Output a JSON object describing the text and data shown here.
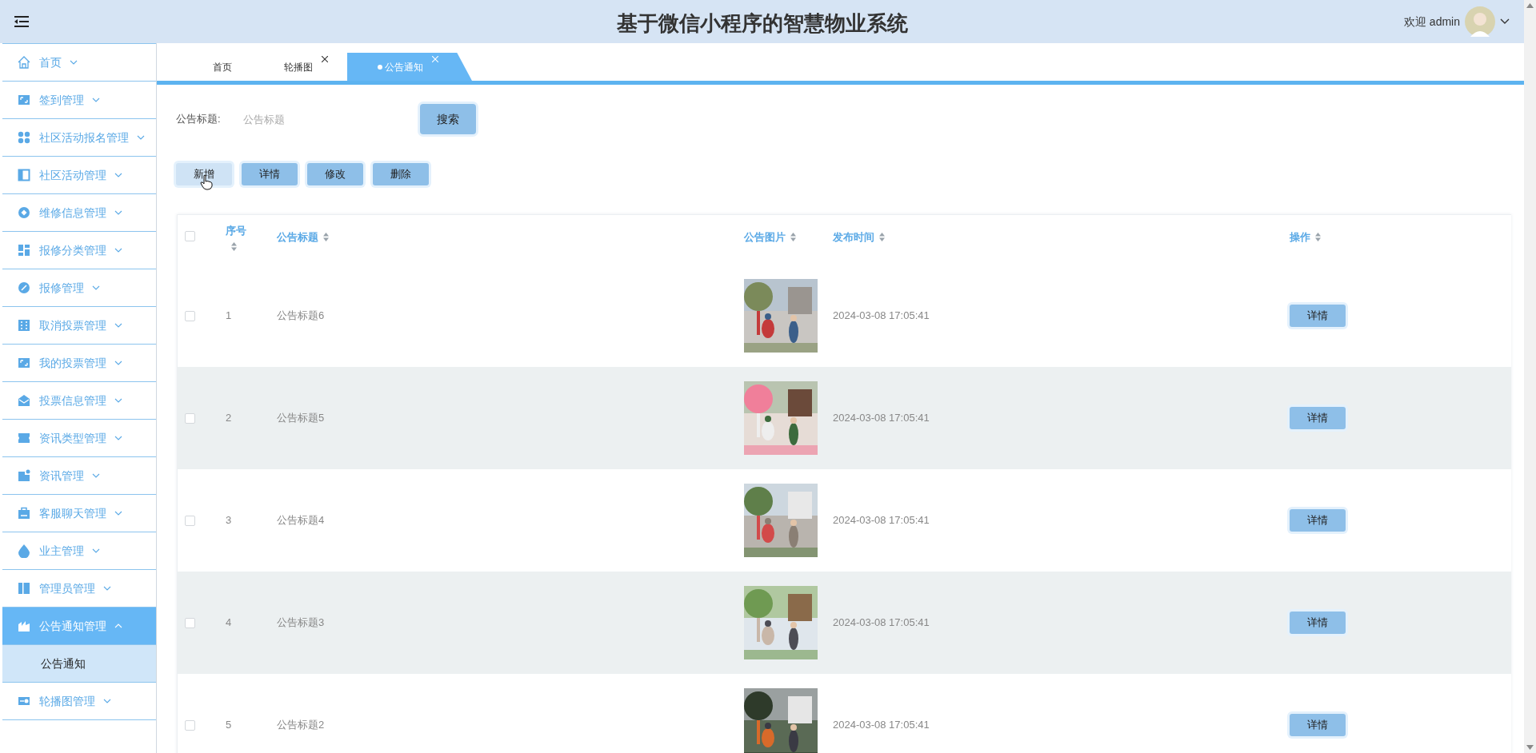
{
  "header": {
    "title": "基于微信小程序的智慧物业系统",
    "welcome": "欢迎 admin"
  },
  "sidebar": {
    "items": [
      {
        "label": "首页",
        "expanded": false,
        "selected": false
      },
      {
        "label": "签到管理",
        "expanded": false,
        "selected": false
      },
      {
        "label": "社区活动报名管理",
        "expanded": false,
        "selected": false
      },
      {
        "label": "社区活动管理",
        "expanded": false,
        "selected": false
      },
      {
        "label": "维修信息管理",
        "expanded": false,
        "selected": false
      },
      {
        "label": "报修分类管理",
        "expanded": false,
        "selected": false
      },
      {
        "label": "报修管理",
        "expanded": false,
        "selected": false
      },
      {
        "label": "取消投票管理",
        "expanded": false,
        "selected": false
      },
      {
        "label": "我的投票管理",
        "expanded": false,
        "selected": false
      },
      {
        "label": "投票信息管理",
        "expanded": false,
        "selected": false
      },
      {
        "label": "资讯类型管理",
        "expanded": false,
        "selected": false
      },
      {
        "label": "资讯管理",
        "expanded": false,
        "selected": false
      },
      {
        "label": "客服聊天管理",
        "expanded": false,
        "selected": false
      },
      {
        "label": "业主管理",
        "expanded": false,
        "selected": false
      },
      {
        "label": "管理员管理",
        "expanded": false,
        "selected": false
      },
      {
        "label": "公告通知管理",
        "expanded": true,
        "selected": true,
        "children": [
          {
            "label": "公告通知",
            "selected": true
          }
        ]
      },
      {
        "label": "轮播图管理",
        "expanded": false,
        "selected": false
      }
    ]
  },
  "tabs": [
    {
      "label": "首页",
      "closable": false,
      "selected": false
    },
    {
      "label": "轮播图",
      "closable": true,
      "selected": false
    },
    {
      "label": "公告通知",
      "closable": true,
      "selected": true
    }
  ],
  "search": {
    "label": "公告标题:",
    "placeholder": "公告标题",
    "button": "搜索"
  },
  "actions": [
    {
      "label": "新增",
      "hovered": true
    },
    {
      "label": "详情",
      "hovered": false
    },
    {
      "label": "修改",
      "hovered": false
    },
    {
      "label": "删除",
      "hovered": false
    }
  ],
  "table": {
    "select_all_checked": false,
    "columns": [
      {
        "label": "序号"
      },
      {
        "label": "公告标题"
      },
      {
        "label": "公告图片"
      },
      {
        "label": "发布时间"
      },
      {
        "label": "操作"
      }
    ],
    "rows": [
      {
        "index": "1",
        "title": "公告标题6",
        "time": "2024-03-08 17:05:41",
        "action": "详情",
        "checked": false
      },
      {
        "index": "2",
        "title": "公告标题5",
        "time": "2024-03-08 17:05:41",
        "action": "详情",
        "checked": false
      },
      {
        "index": "3",
        "title": "公告标题4",
        "time": "2024-03-08 17:05:41",
        "action": "详情",
        "checked": false
      },
      {
        "index": "4",
        "title": "公告标题3",
        "time": "2024-03-08 17:05:41",
        "action": "详情",
        "checked": false
      },
      {
        "index": "5",
        "title": "公告标题2",
        "time": "2024-03-08 17:05:41",
        "action": "详情",
        "checked": false
      }
    ]
  }
}
